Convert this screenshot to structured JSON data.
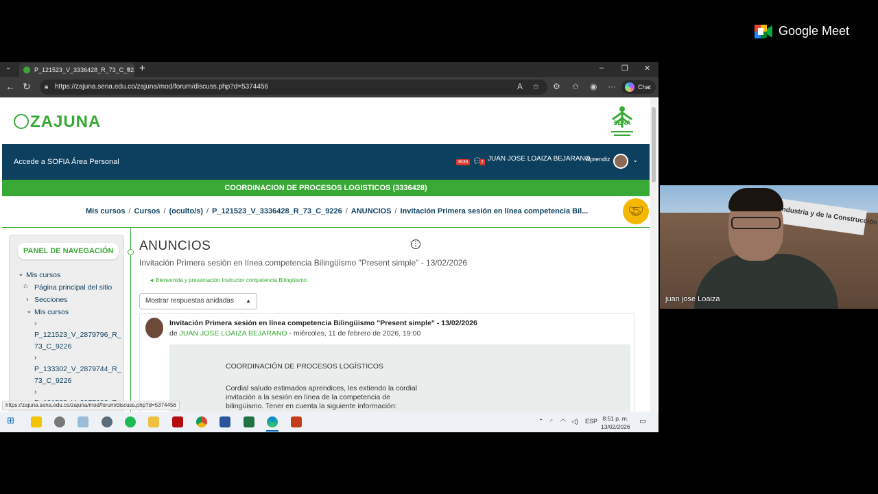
{
  "browser": {
    "tab_title": "P_121523_V_3336428_R_73_C_9226",
    "tab_close": "×",
    "new_tab": "+",
    "url": "https://zajuna.sena.edu.co/zajuna/mod/forum/discuss.php?d=5374456",
    "chat_label": "Chat",
    "status_url": "https://zajuna.sena.edu.co/zajuna/mod/forum/discuss.php?d=5374456"
  },
  "site": {
    "logo_text": "ZAJUNA",
    "sena_label": "SENA",
    "nav_links": [
      "Accede a SOFIA",
      "Área Personal"
    ],
    "notif_count": "3636",
    "msg_count": "2",
    "user_name": "JUAN JOSE LOAIZA BEJARANO",
    "user_role": "Aprendiz",
    "course_title": "COORDINACION DE PROCESOS LOGISTICOS (3336428)",
    "breadcrumbs": [
      "Mis cursos",
      "Cursos",
      "(oculto/s)",
      "P_121523_V_3336428_R_73_C_9226",
      "ANUNCIOS",
      "Invitación Primera sesión en línea competencia Bil..."
    ]
  },
  "panel": {
    "title": "PANEL DE NAVEGACIÓN",
    "items": [
      "Mis cursos",
      "Página principal del sitio",
      "Secciones",
      "Mis cursos",
      "P_121523_V_2879796_R_",
      "73_C_9226",
      "P_133302_V_2879744_R_",
      "73_C_9226",
      "P_121523_V_2977602_R_"
    ]
  },
  "main": {
    "title": "ANUNCIOS",
    "subtitle": "Invitación Primera sesión en línea competencia Bilingüismo \"Present simple\" - 13/02/2026",
    "prev_link": "◄ Bienvenida y presentación Instructor competencia Bilingüismo",
    "display_mode": "Mostrar respuestas anidadas",
    "post": {
      "title": "Invitación Primera sesión en línea competencia Bilingüismo \"Present simple\" - 13/02/2026",
      "by": "de",
      "author": "JUAN JOSE LOAIZA BEJARANO",
      "date": " - miércoles, 11 de febrero de 2026, 19:00",
      "body_heading": "COORDINACIÓN DE PROCESOS LOGÍSTICOS",
      "body_lines": [
        "Cordial saludo estimados aprendices, les extiendo la cordial",
        "invitación a la sesión en línea de la competencia de",
        "bilingüismo. Tener en cuenta la siguiente información:"
      ]
    }
  },
  "taskbar": {
    "time": "8:51 p. m.",
    "date": "13/02/2026",
    "lang": "ESP"
  },
  "meet": {
    "brand": "Google Meet",
    "participant": "juan jose Loaiza",
    "sign_text": "Industria y de la Construcción"
  }
}
